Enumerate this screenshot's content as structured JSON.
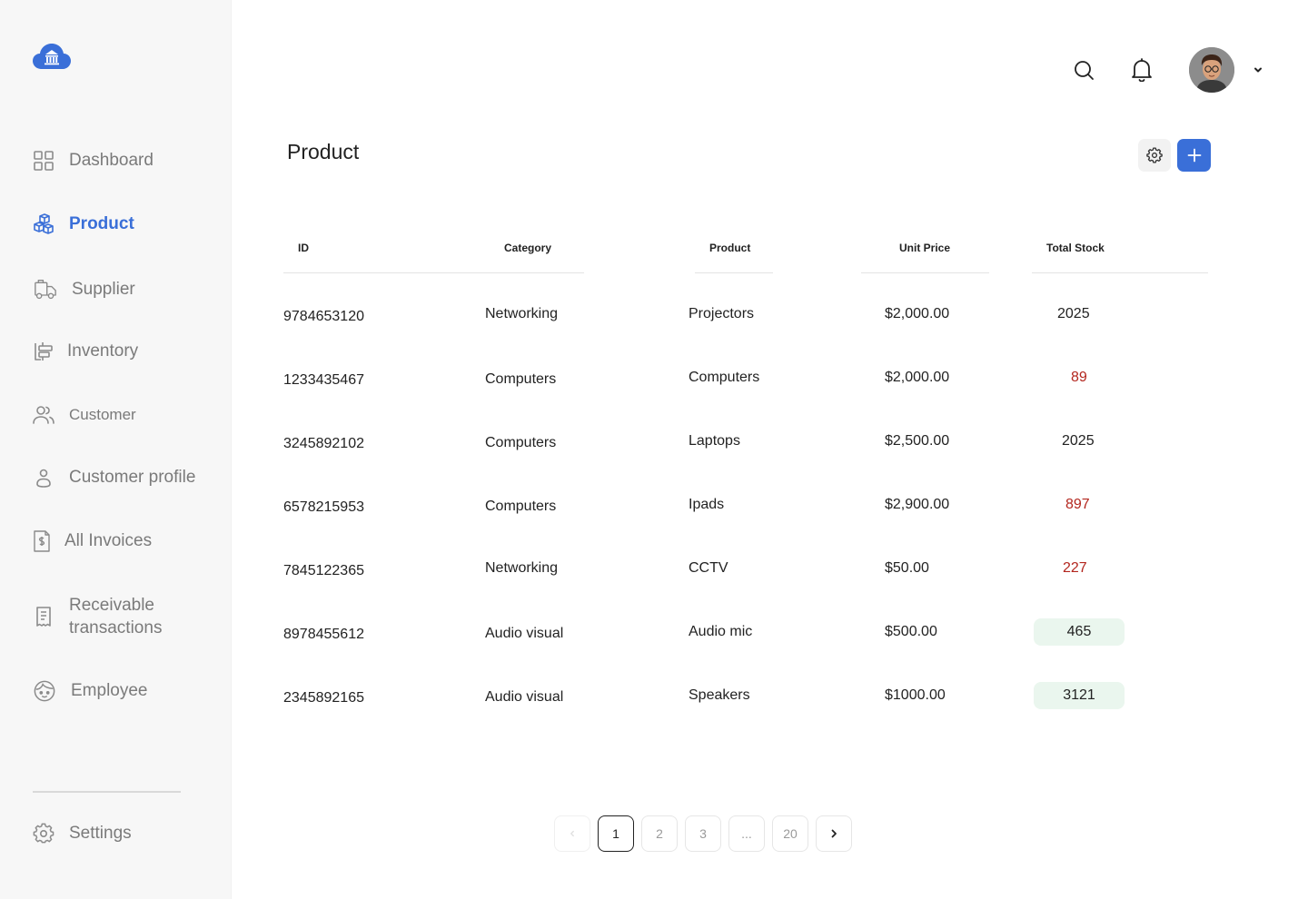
{
  "sidebar": {
    "logo": "bank-cloud-logo",
    "items": [
      {
        "label": "Dashboard",
        "icon": "grid-icon"
      },
      {
        "label": "Product",
        "icon": "boxes-icon",
        "active": true
      },
      {
        "label": "Supplier",
        "icon": "truck-icon"
      },
      {
        "label": "Inventory",
        "icon": "inventory-icon"
      },
      {
        "label": "Customer",
        "icon": "users-icon"
      },
      {
        "label": "Customer profile",
        "icon": "user-icon"
      },
      {
        "label": "All Invoices",
        "icon": "invoice-icon"
      },
      {
        "label_line1": "Receivable",
        "label_line2": "transactions",
        "icon": "receipt-icon"
      },
      {
        "label": "Employee",
        "icon": "employee-icon"
      }
    ],
    "settings": {
      "label": "Settings",
      "icon": "gear-icon"
    }
  },
  "topbar": {
    "search_icon": "search-icon",
    "bell_icon": "bell-icon",
    "avatar": "user-avatar",
    "dropdown_icon": "chevron-down-icon"
  },
  "page": {
    "title": "Product",
    "settings_icon": "gear-icon",
    "add_icon": "plus-icon"
  },
  "table": {
    "columns": [
      "ID",
      "Category",
      "Product",
      "Unit Price",
      "Total Stock"
    ],
    "rows": [
      {
        "id": "9784653120",
        "category": "Networking",
        "product": "Projectors",
        "price": "$2,000.00",
        "stock": "2025",
        "stock_style": "normal"
      },
      {
        "id": "1233435467",
        "category": "Computers",
        "product": "Computers",
        "price": "$2,000.00",
        "stock": "89",
        "stock_style": "low"
      },
      {
        "id": "3245892102",
        "category": "Computers",
        "product": "Laptops",
        "price": "$2,500.00",
        "stock": "2025",
        "stock_style": "normal"
      },
      {
        "id": "6578215953",
        "category": "Computers",
        "product": "Ipads",
        "price": "$2,900.00",
        "stock": "897",
        "stock_style": "low"
      },
      {
        "id": "7845122365",
        "category": "Networking",
        "product": "CCTV",
        "price": "$50.00",
        "stock": "227",
        "stock_style": "low"
      },
      {
        "id": "8978455612",
        "category": "Audio visual",
        "product": "Audio mic",
        "price": "$500.00",
        "stock": "465",
        "stock_style": "badge"
      },
      {
        "id": "2345892165",
        "category": "Audio visual",
        "product": "Speakers",
        "price": "$1000.00",
        "stock": "3121",
        "stock_style": "badge"
      }
    ]
  },
  "pagination": {
    "prev_icon": "chevron-left-icon",
    "pages": [
      "1",
      "2",
      "3",
      "...",
      "20"
    ],
    "current": "1",
    "next_icon": "chevron-right-icon"
  },
  "colors": {
    "accent": "#3a6fd8",
    "low_stock": "#b3261e",
    "badge_bg": "#eaf6ee"
  }
}
